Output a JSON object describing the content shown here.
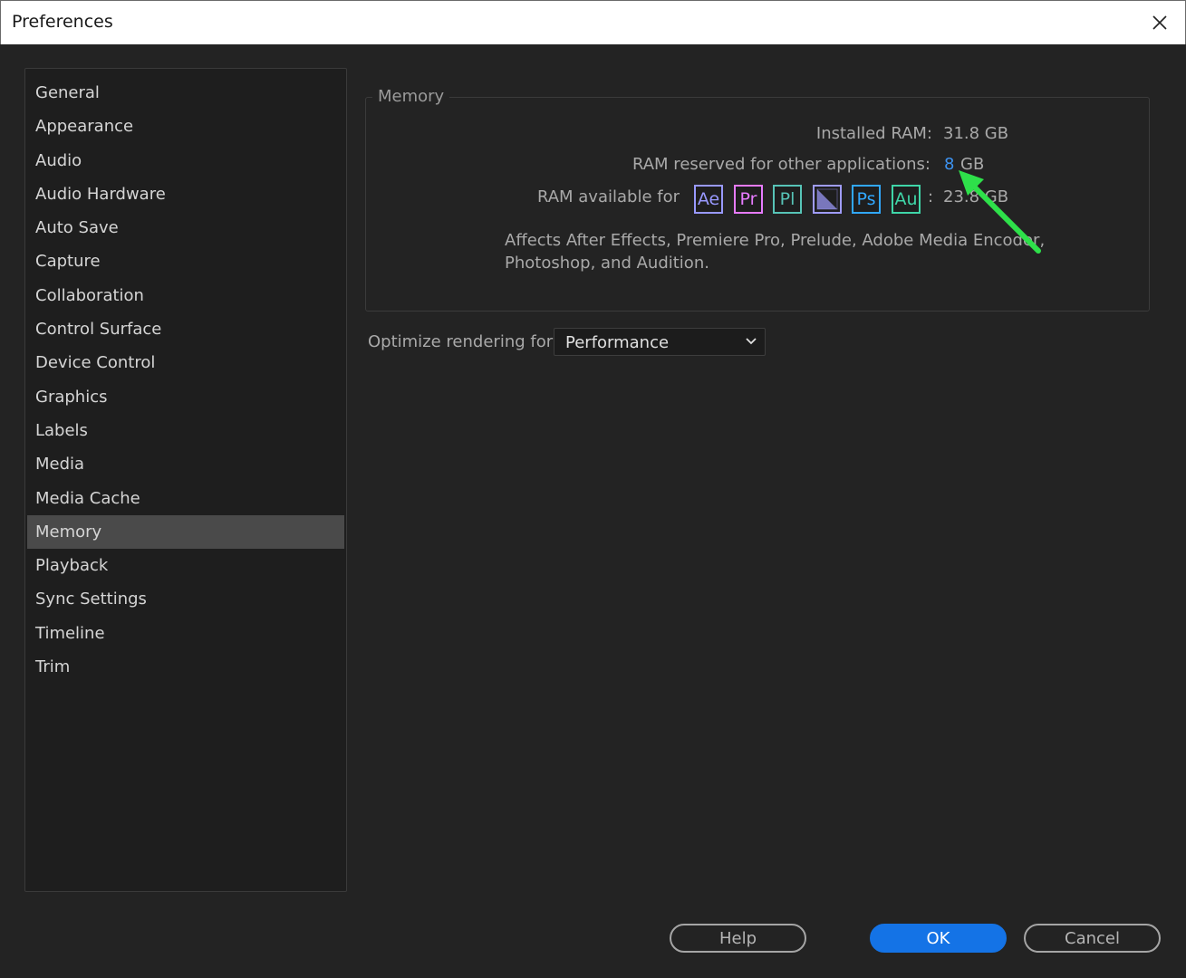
{
  "window": {
    "title": "Preferences"
  },
  "sidebar": {
    "items": [
      {
        "label": "General"
      },
      {
        "label": "Appearance"
      },
      {
        "label": "Audio"
      },
      {
        "label": "Audio Hardware"
      },
      {
        "label": "Auto Save"
      },
      {
        "label": "Capture"
      },
      {
        "label": "Collaboration"
      },
      {
        "label": "Control Surface"
      },
      {
        "label": "Device Control"
      },
      {
        "label": "Graphics"
      },
      {
        "label": "Labels"
      },
      {
        "label": "Media"
      },
      {
        "label": "Media Cache"
      },
      {
        "label": "Memory"
      },
      {
        "label": "Playback"
      },
      {
        "label": "Sync Settings"
      },
      {
        "label": "Timeline"
      },
      {
        "label": "Trim"
      }
    ],
    "selected": "Memory"
  },
  "memory": {
    "group_title": "Memory",
    "installed_label": "Installed RAM:",
    "installed_value": "31.8 GB",
    "reserved_label": "RAM reserved for other applications:",
    "reserved_value": "8",
    "reserved_unit": "GB",
    "available_label": "RAM available for",
    "available_colon": ":",
    "available_value": "23.8 GB",
    "apps": [
      {
        "name": "after-effects-icon",
        "text": "Ae",
        "color": "#9999ff"
      },
      {
        "name": "premiere-pro-icon",
        "text": "Pr",
        "color": "#e77bff"
      },
      {
        "name": "prelude-icon",
        "text": "Pl",
        "color": "#57c4b7"
      },
      {
        "name": "media-encoder-icon",
        "text": "",
        "color": "#a09cff"
      },
      {
        "name": "photoshop-icon",
        "text": "Ps",
        "color": "#31a8ff"
      },
      {
        "name": "audition-icon",
        "text": "Au",
        "color": "#3fd6a8"
      }
    ],
    "note_line1": "Affects After Effects, Premiere Pro, Prelude, Adobe Media Encoder,",
    "note_line2": "Photoshop, and Audition."
  },
  "optimize": {
    "label": "Optimize rendering for:",
    "value": "Performance"
  },
  "buttons": {
    "help": "Help",
    "ok": "OK",
    "cancel": "Cancel"
  },
  "colors": {
    "accent": "#1473e6",
    "link": "#3d93f2",
    "annotation_arrow": "#2ee04a"
  }
}
